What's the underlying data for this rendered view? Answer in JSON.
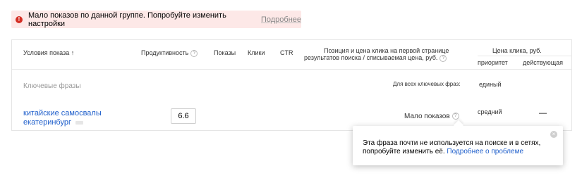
{
  "warning": {
    "icon": "exclamation-icon",
    "text": "Мало показов по данной группе. Попробуйте изменить настройки",
    "more_link": "Подробнее"
  },
  "table": {
    "headers": {
      "conditions": "Условия показа",
      "sort_arrow": "↑",
      "productivity": "Продуктивность",
      "shows": "Показы",
      "clicks": "Клики",
      "ctr": "CTR",
      "position_line1": "Позиция и цена клика на первой странице",
      "position_line2": "результатов поиска / списываемая цена, руб.",
      "price_group": "Цена клика, руб.",
      "priority": "приоритет",
      "current": "действующая"
    },
    "group_label": "Ключевые фразы",
    "all_phrases_label": "Для всех ключевых фраз:",
    "single_value": "единый",
    "rows": [
      {
        "phrase_line1": "китайские самосвалы",
        "phrase_line2": "екатеринбург",
        "productivity": "6.6",
        "position_status": "Мало показов",
        "priority": "средний",
        "current": "—"
      }
    ]
  },
  "tooltip": {
    "text_line1": "Эта фраза почти не используется на поиске и в сетях,",
    "text_line2_prefix": "попробуйте изменить её.",
    "link": "Подробнее о проблеме",
    "close": "×"
  },
  "colors": {
    "warning_bg": "#fde8e7",
    "warning_icon": "#d42e24",
    "link": "#1f5fcb"
  }
}
